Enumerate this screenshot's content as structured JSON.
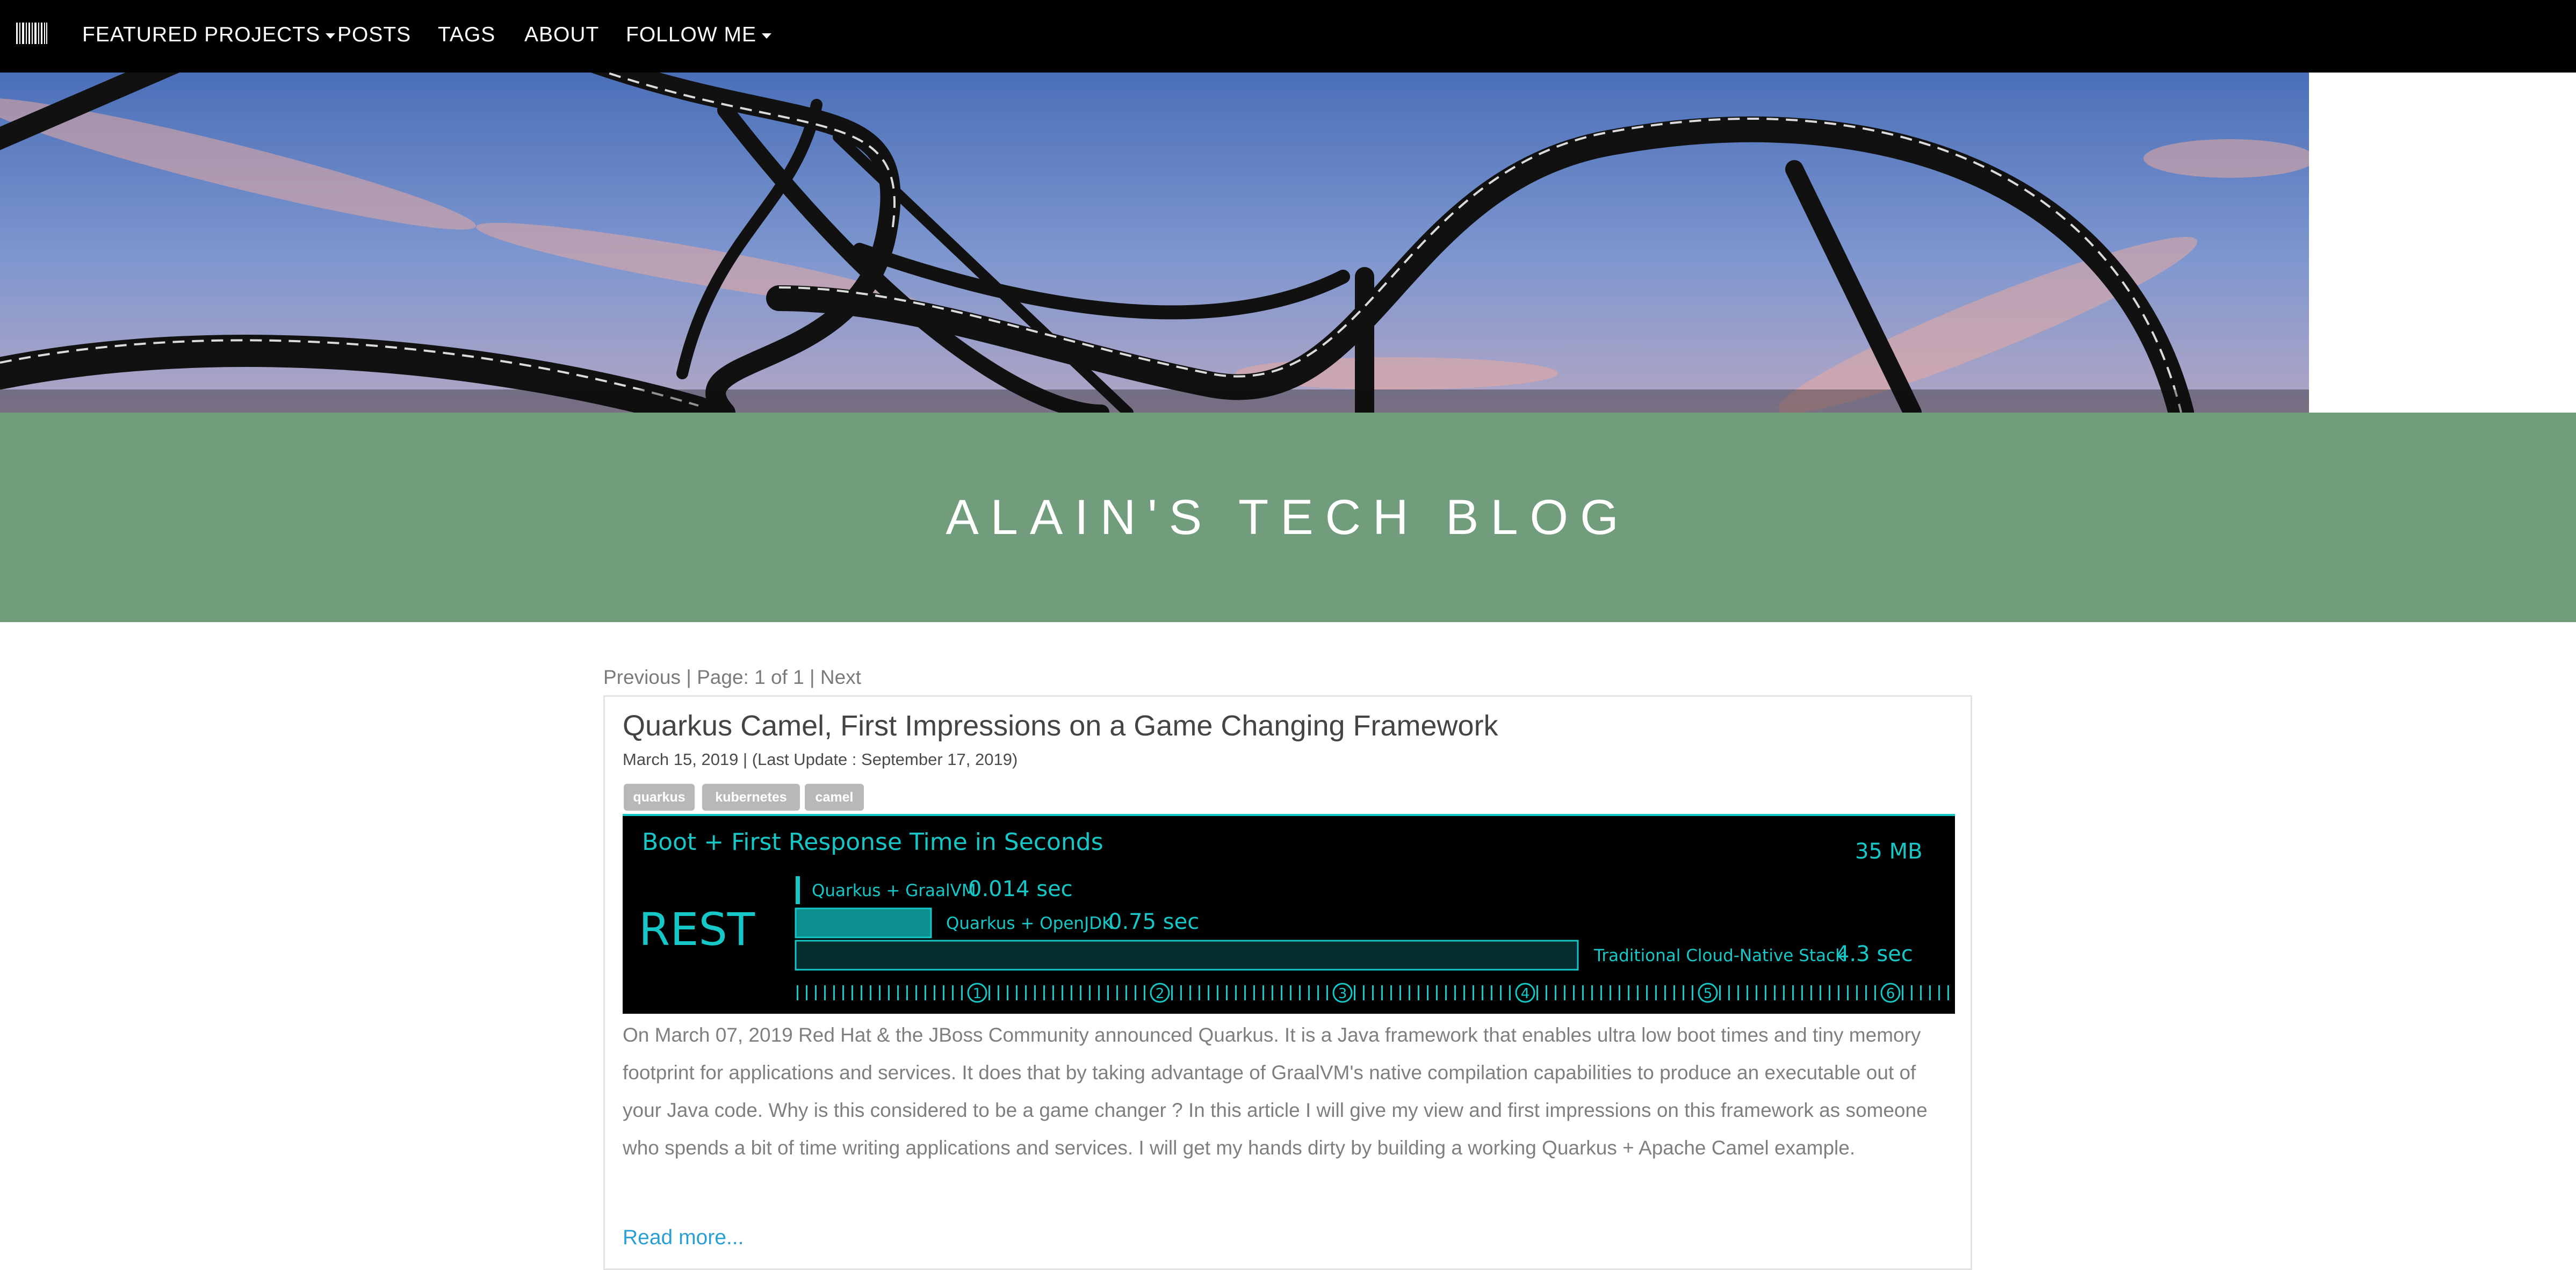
{
  "nav": {
    "logo_icon": "barcode-logo-icon",
    "items": [
      {
        "label": "FEATURED PROJECTS",
        "has_dropdown": true
      },
      {
        "label": "POSTS",
        "has_dropdown": false
      },
      {
        "label": "TAGS",
        "has_dropdown": false
      },
      {
        "label": "ABOUT",
        "has_dropdown": false
      },
      {
        "label": "FOLLOW ME",
        "has_dropdown": true
      }
    ]
  },
  "hero": {
    "subject": "roller-coaster sculpture against blue sky"
  },
  "banner": {
    "title": "ALAIN'S TECH BLOG",
    "color": "#729d7d"
  },
  "pager": {
    "previous": "Previous",
    "sep1": " | ",
    "page_label": "Page: 1 of 1",
    "sep2": " | ",
    "next": "Next"
  },
  "post": {
    "title": "Quarkus Camel, First Impressions on a Game Changing Framework",
    "date": "March 15, 2019 | (Last Update : September 17, 2019)",
    "tags": [
      "quarkus",
      "kubernetes",
      "camel"
    ],
    "excerpt": "On March 07, 2019 Red Hat & the JBoss Community announced Quarkus. It is a Java framework that enables ultra low boot times and tiny memory footprint for applications and services. It does that by taking advantage of GraalVM's native compilation capabilities to produce an executable out of your Java code. Why is this considered to be a game changer ? In this article I will give my view and first impressions on this framework as someone who spends a bit of time writing applications and services. I will get my hands dirty by building a working Quarkus + Apache Camel example.",
    "read_more": "Read more..."
  },
  "post_image": {
    "title": "Boot + First Response Time in Seconds",
    "memory": "35 MB",
    "label": "REST",
    "accent": "#16c7c7",
    "bars": [
      {
        "name": "Quarkus + GraalVM",
        "value_label": "0.014 sec",
        "value": 0.014
      },
      {
        "name": "Quarkus + OpenJDK",
        "value_label": "0.75 sec",
        "value": 0.75
      },
      {
        "name": "Traditional Cloud-Native Stack",
        "value_label": "4.3 sec",
        "value": 4.3
      }
    ],
    "ticks": [
      "1",
      "2",
      "3",
      "4",
      "5",
      "6"
    ]
  }
}
